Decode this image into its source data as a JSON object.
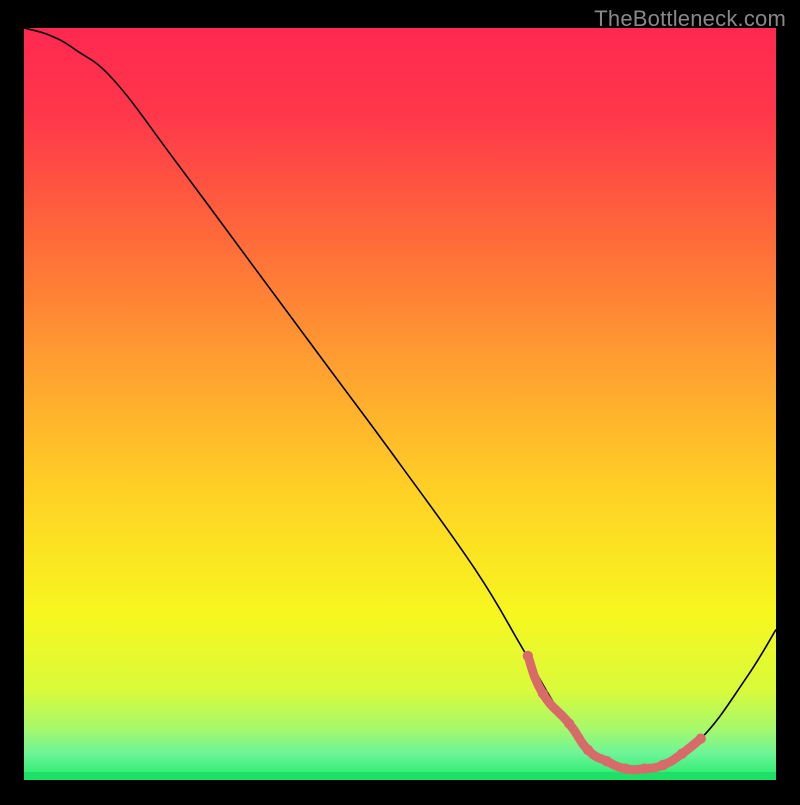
{
  "watermark": "TheBottleneck.com",
  "chart_data": {
    "type": "line",
    "title": "",
    "xlabel": "",
    "ylabel": "",
    "xlim": [
      0,
      100
    ],
    "ylim": [
      0,
      100
    ],
    "background_gradient": {
      "stops": [
        {
          "offset": 0.0,
          "color": "#ff2850"
        },
        {
          "offset": 0.12,
          "color": "#ff384a"
        },
        {
          "offset": 0.28,
          "color": "#ff6a3a"
        },
        {
          "offset": 0.45,
          "color": "#ffa030"
        },
        {
          "offset": 0.62,
          "color": "#ffd225"
        },
        {
          "offset": 0.78,
          "color": "#f7f71f"
        },
        {
          "offset": 0.88,
          "color": "#d9fb3a"
        },
        {
          "offset": 0.93,
          "color": "#a8f86a"
        },
        {
          "offset": 0.965,
          "color": "#6cf598"
        },
        {
          "offset": 1.0,
          "color": "#20e96a"
        }
      ]
    },
    "series": [
      {
        "name": "bottleneck-curve",
        "color": "#000000",
        "width": 1.6,
        "x": [
          0.0,
          3.5,
          7.0,
          12.0,
          20.0,
          30.0,
          40.0,
          50.0,
          60.0,
          66.0,
          70.0,
          73.0,
          76.0,
          80.0,
          84.0,
          90.0,
          96.0,
          100.0
        ],
        "values": [
          100.0,
          99.0,
          97.0,
          93.0,
          82.5,
          69.0,
          55.5,
          42.0,
          28.0,
          18.0,
          11.0,
          6.5,
          3.5,
          1.5,
          1.5,
          5.5,
          13.5,
          20.0
        ]
      }
    ],
    "highlight_points": {
      "color": "#d86a6a",
      "radius": 4.5,
      "x": [
        67.0,
        69.0,
        72.5,
        75.0,
        77.5,
        80.0,
        82.5,
        85.0,
        87.5,
        90.0
      ],
      "values": [
        16.5,
        11.5,
        7.5,
        4.0,
        2.5,
        1.5,
        1.5,
        2.0,
        3.5,
        5.5
      ]
    }
  }
}
